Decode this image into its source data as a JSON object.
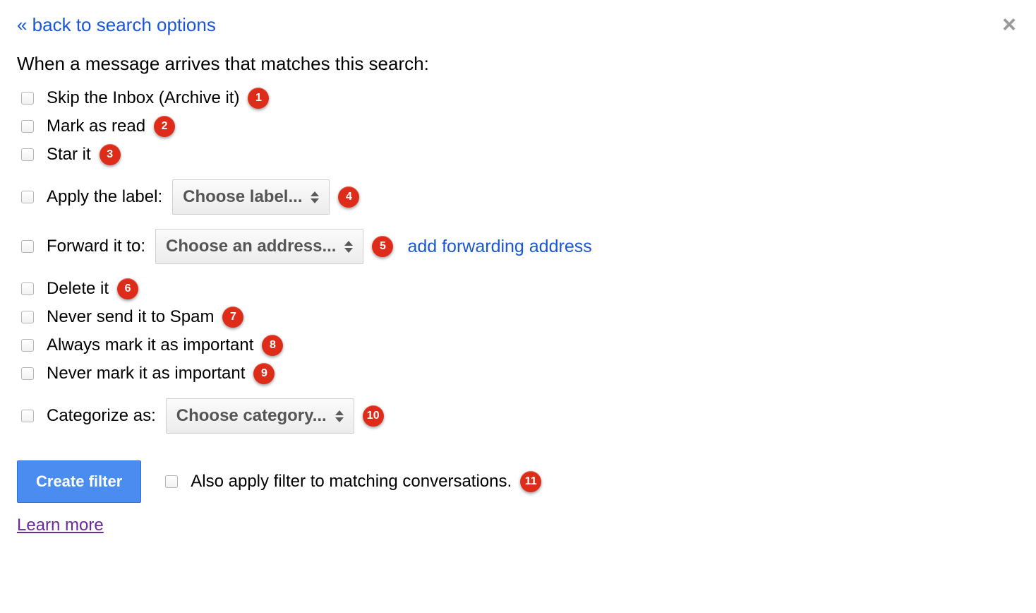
{
  "header": {
    "back_link": "« back to search options",
    "close_symbol": "×",
    "heading": "When a message arrives that matches this search:"
  },
  "options": {
    "skip_inbox": "Skip the Inbox (Archive it)",
    "mark_read": "Mark as read",
    "star_it": "Star it",
    "apply_label": "Apply the label:",
    "apply_label_select": "Choose label...",
    "forward_to": "Forward it to:",
    "forward_select": "Choose an address...",
    "add_forwarding_link": "add forwarding address",
    "delete_it": "Delete it",
    "never_spam": "Never send it to Spam",
    "always_important": "Always mark it as important",
    "never_important": "Never mark it as important",
    "categorize_as": "Categorize as:",
    "categorize_select": "Choose category..."
  },
  "badges": {
    "b1": "1",
    "b2": "2",
    "b3": "3",
    "b4": "4",
    "b5": "5",
    "b6": "6",
    "b7": "7",
    "b8": "8",
    "b9": "9",
    "b10": "10",
    "b11": "11"
  },
  "footer": {
    "create_button": "Create filter",
    "also_apply": "Also apply filter to matching conversations.",
    "learn_more": "Learn more"
  }
}
